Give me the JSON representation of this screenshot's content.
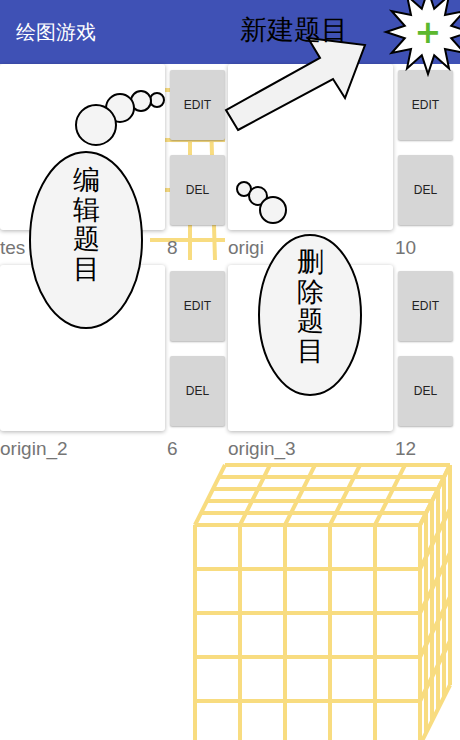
{
  "app_bar": {
    "title": "绘图游戏",
    "new_button": {
      "icon": "+"
    }
  },
  "puzzles": [
    {
      "name": "tes",
      "count": "8",
      "edit_label": "EDIT",
      "delete_label": "DEL"
    },
    {
      "name": "origi",
      "count": "10",
      "edit_label": "EDIT",
      "delete_label": "DEL"
    },
    {
      "name": "origin_2",
      "count": "6",
      "edit_label": "EDIT",
      "delete_label": "DEL"
    },
    {
      "name": "origin_3",
      "count": "12",
      "edit_label": "EDIT",
      "delete_label": "DEL"
    }
  ],
  "annotations": {
    "new": "新建题目",
    "edit": "编辑题目",
    "delete": "删除题目"
  }
}
